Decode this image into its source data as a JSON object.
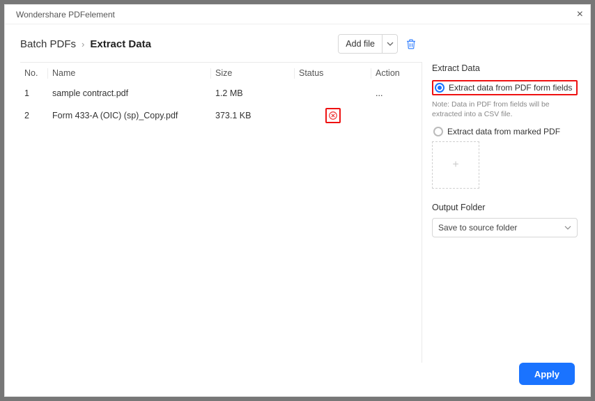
{
  "title": "Wondershare PDFelement",
  "breadcrumb": {
    "root": "Batch PDFs",
    "current": "Extract Data"
  },
  "toolbar": {
    "add_file": "Add file"
  },
  "columns": {
    "no": "No.",
    "name": "Name",
    "size": "Size",
    "status": "Status",
    "action": "Action"
  },
  "rows": [
    {
      "no": "1",
      "name": "sample contract.pdf",
      "size": "1.2 MB",
      "status": "",
      "action": "..."
    },
    {
      "no": "2",
      "name": "Form 433-A (OIC) (sp)_Copy.pdf",
      "size": "373.1 KB",
      "status": "error",
      "action": ""
    }
  ],
  "side": {
    "title": "Extract Data",
    "option_form": "Extract data from PDF form fields",
    "note": "Note: Data in PDF from fields will be extracted into a CSV file.",
    "option_marked": "Extract data from marked PDF",
    "output_title": "Output Folder",
    "output_value": "Save to source folder"
  },
  "footer": {
    "apply": "Apply"
  }
}
